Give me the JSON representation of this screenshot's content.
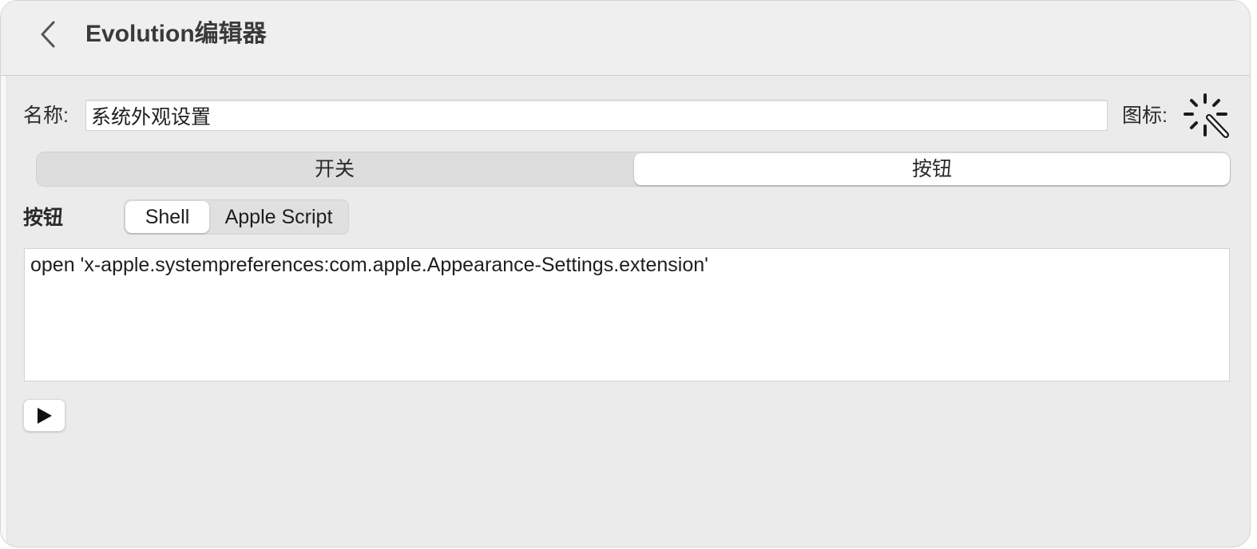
{
  "window": {
    "title": "Evolution编辑器",
    "back_icon": "chevron-left-icon"
  },
  "form": {
    "name_label": "名称:",
    "name_value": "系统外观设置",
    "icon_label": "图标:",
    "icon_name": "magic-wand-icon"
  },
  "mode_tabs": {
    "items": [
      "开关",
      "按钮"
    ],
    "selected": "按钮"
  },
  "button_section": {
    "label": "按钮",
    "languages": [
      "Shell",
      "Apple Script"
    ],
    "selected_language": "Shell",
    "script": "open 'x-apple.systempreferences:com.apple.Appearance-Settings.extension'",
    "run_icon": "play-icon"
  }
}
